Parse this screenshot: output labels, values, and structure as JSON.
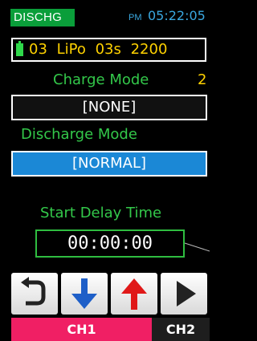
{
  "status": {
    "mode": "DISCHG",
    "ampm": "PM",
    "time": "05:22:05"
  },
  "battery": {
    "text": "03 LiPo 03s 2200"
  },
  "charge_mode": {
    "label": "Charge Mode",
    "suffix": "2",
    "value": "[NONE]"
  },
  "discharge_mode": {
    "label": "Discharge Mode",
    "value": "[NORMAL]"
  },
  "start_delay": {
    "label": "Start Delay Time",
    "value": "00:00:00"
  },
  "buttons": [
    "back-icon",
    "down-arrow-icon",
    "up-arrow-icon",
    "play-icon"
  ],
  "tabs": [
    {
      "label": "CH1"
    },
    {
      "label": "CH2"
    }
  ],
  "colors": {
    "accent_blue": "#1b88d6",
    "badge_green": "#0a9e3a",
    "label_green": "#33c84a",
    "value_yellow": "#ffd200",
    "tab_active": "#f01f64"
  }
}
